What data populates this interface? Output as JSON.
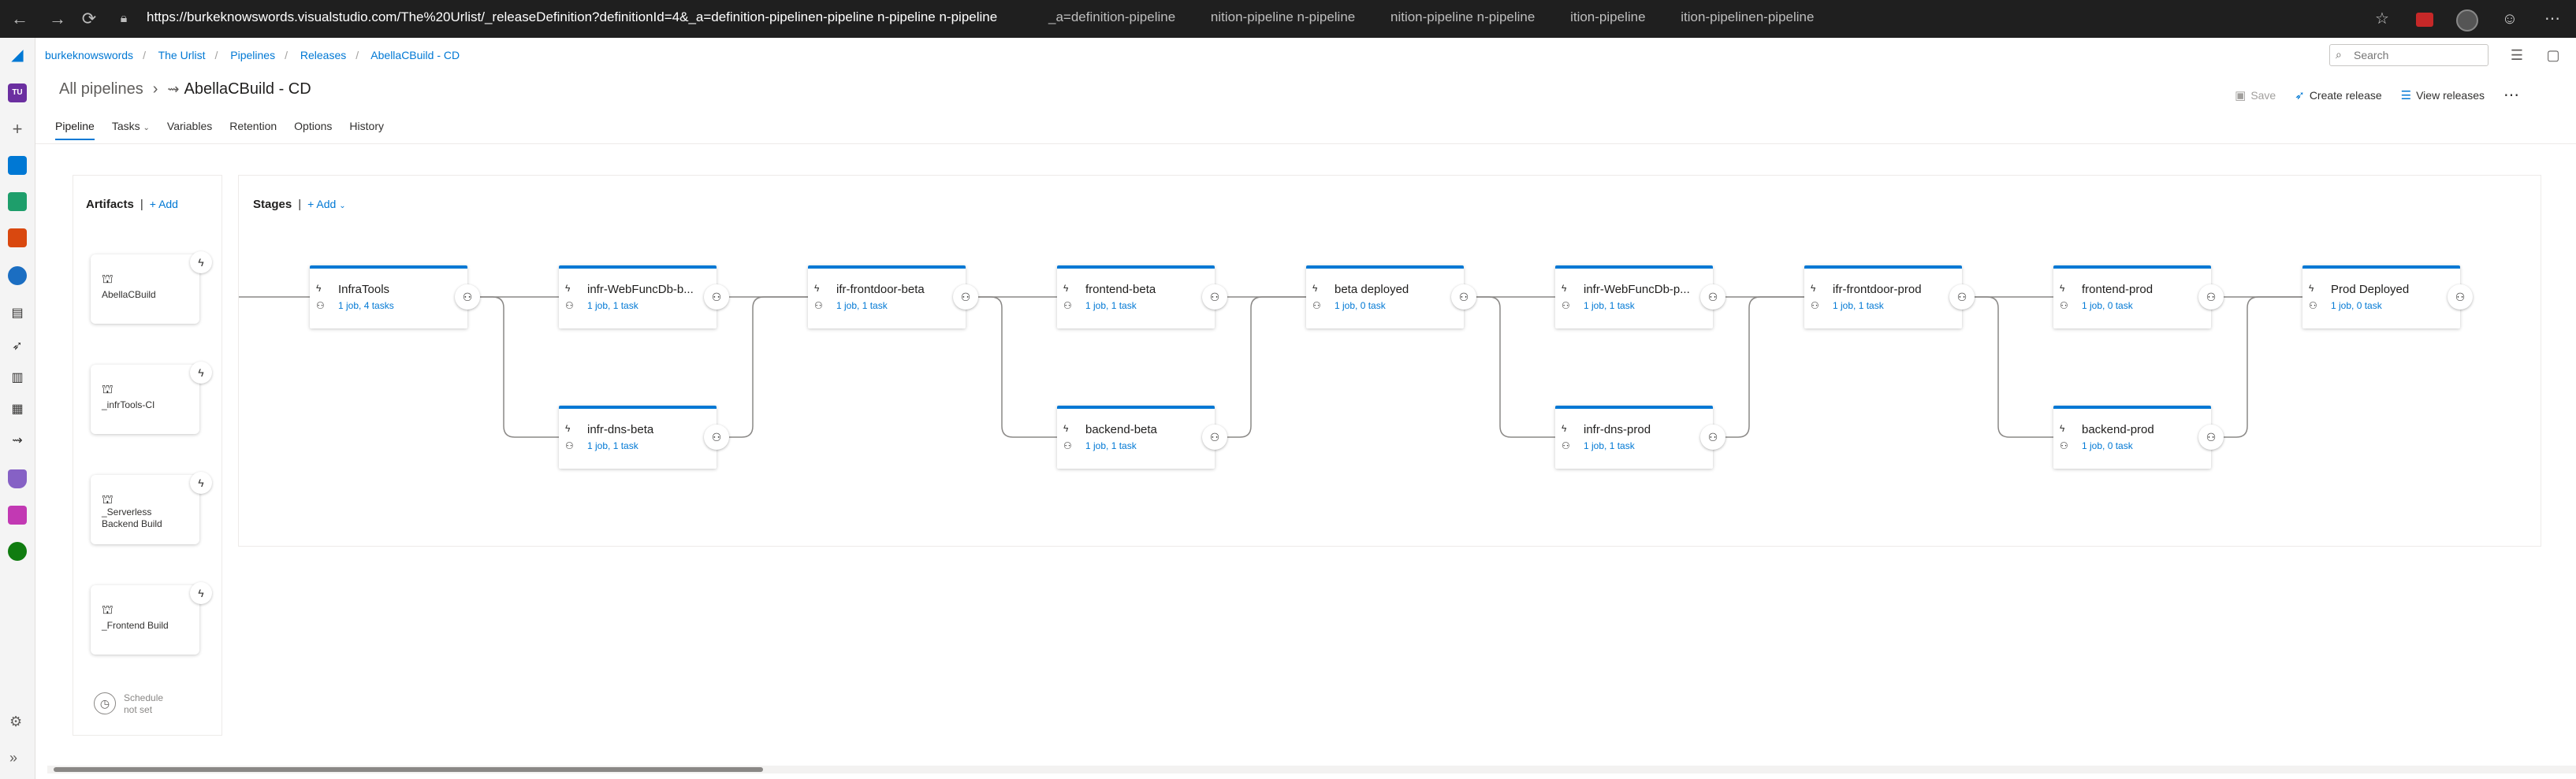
{
  "browser": {
    "url": "https://burkeknowswords.visualstudio.com/The%20Urlist/_releaseDefinition?definitionId=4&_a=definition-pipelinen-pipeline n-pipeline n-pipeline",
    "ghost_tabs": [
      "_a=definition-pipeline",
      "nition-pipeline n-pipeline",
      "nition-pipeline n-pipeline",
      "ition-pipeline",
      "ition-pipelinen-pipeline"
    ]
  },
  "breadcrumb": [
    "burkeknowswords",
    "The Urlist",
    "Pipelines",
    "Releases",
    "AbellaCBuild - CD"
  ],
  "search": {
    "placeholder": "Search"
  },
  "title": {
    "all_pipelines": "All pipelines",
    "pipeline_name": "AbellaCBuild - CD"
  },
  "actions": {
    "save": "Save",
    "create_release": "Create release",
    "view_releases": "View releases"
  },
  "tabs": [
    "Pipeline",
    "Tasks",
    "Variables",
    "Retention",
    "Options",
    "History"
  ],
  "artifacts": {
    "header": "Artifacts",
    "add_label": "Add",
    "items": [
      "AbellaCBuild",
      "_infrTools-CI",
      "_Serverless Backend Build",
      "_Frontend Build"
    ],
    "schedule_label": "Schedule not set"
  },
  "stages": {
    "header": "Stages",
    "add_label": "Add",
    "items": [
      {
        "name": "InfraTools",
        "sub": "1 job, 4 tasks"
      },
      {
        "name": "infr-WebFuncDb-b...",
        "sub": "1 job, 1 task"
      },
      {
        "name": "infr-dns-beta",
        "sub": "1 job, 1 task"
      },
      {
        "name": "ifr-frontdoor-beta",
        "sub": "1 job, 1 task"
      },
      {
        "name": "frontend-beta",
        "sub": "1 job, 1 task"
      },
      {
        "name": "backend-beta",
        "sub": "1 job, 1 task"
      },
      {
        "name": "beta deployed",
        "sub": "1 job, 0 task"
      },
      {
        "name": "infr-WebFuncDb-p...",
        "sub": "1 job, 1 task"
      },
      {
        "name": "infr-dns-prod",
        "sub": "1 job, 1 task"
      },
      {
        "name": "ifr-frontdoor-prod",
        "sub": "1 job, 1 task"
      },
      {
        "name": "frontend-prod",
        "sub": "1 job, 0 task"
      },
      {
        "name": "backend-prod",
        "sub": "1 job, 0 task"
      },
      {
        "name": "Prod Deployed",
        "sub": "1 job, 0 task"
      }
    ]
  },
  "colors": {
    "accent": "#0078d4",
    "browser_bar": "#1f1f1f",
    "rail": "#f4f4f4"
  },
  "icons": [
    "search-icon",
    "person-icon",
    "lightning-icon",
    "clock-icon",
    "build-icon",
    "rocket-icon",
    "gear-icon"
  ]
}
